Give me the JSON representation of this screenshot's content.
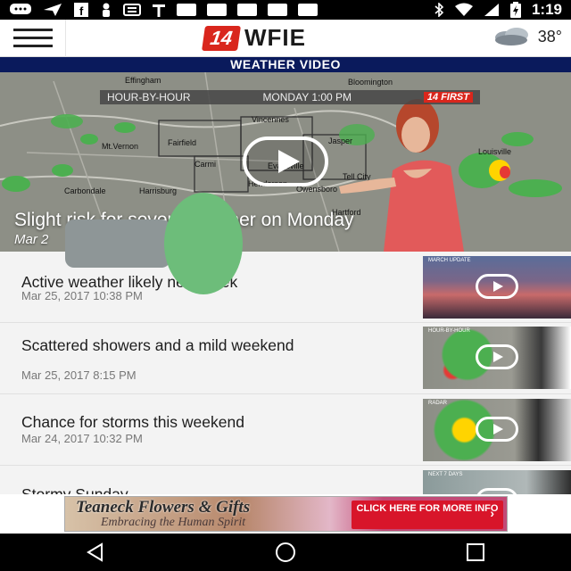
{
  "status_bar": {
    "time": "1:19",
    "icons": [
      "message-icon",
      "send-icon",
      "facebook-icon",
      "person-icon",
      "news-icon",
      "t-icon",
      "bluetooth-icon",
      "wifi-icon",
      "signal-icon",
      "battery-icon"
    ]
  },
  "header": {
    "logo_badge": "14",
    "logo_text": "WFIE",
    "temperature": "38°",
    "weather_icon": "cloudy-icon"
  },
  "section": {
    "title": "WEATHER VIDEO"
  },
  "hero": {
    "bar_left": "HOUR-BY-HOUR",
    "bar_right": "MONDAY  1:00 PM",
    "bar_badge": "14 FIRST",
    "title": "Slight risk for severe weather on Monday",
    "date": "Mar 2",
    "map_labels": [
      "Effingham",
      "Bloomington",
      "Vincennes",
      "Jasper",
      "Fairfield",
      "Mt.Vernon",
      "Carmi",
      "Carbondale",
      "Harrisburg",
      "Owensboro",
      "Tell City",
      "Louisville",
      "Hartford",
      "Henderson",
      "Evansville"
    ]
  },
  "colors": {
    "accent_red": "#d9261c",
    "navy": "#0a1a5c",
    "list_bg": "#f3f3f3",
    "radar_green": "#4caf50"
  },
  "videos": [
    {
      "title": "Active weather likely next week",
      "date": "Mar 25, 2017 10:38 PM",
      "thumb_label": "MARCH UPDATE"
    },
    {
      "title": "Scattered showers and a mild weekend",
      "date": "Mar 25, 2017 8:15 PM",
      "thumb_label": "HOUR-BY-HOUR"
    },
    {
      "title": "Chance for storms this weekend",
      "date": "Mar 24, 2017 10:32 PM",
      "thumb_label": "RADAR"
    },
    {
      "title": "Stormy Sunday",
      "date": "",
      "thumb_label": "NEXT 7 DAYS"
    }
  ],
  "ad": {
    "line1": "Teaneck Flowers & Gifts",
    "line2": "Embracing the Human Spirit",
    "cta": "CLICK HERE FOR MORE INFO"
  }
}
